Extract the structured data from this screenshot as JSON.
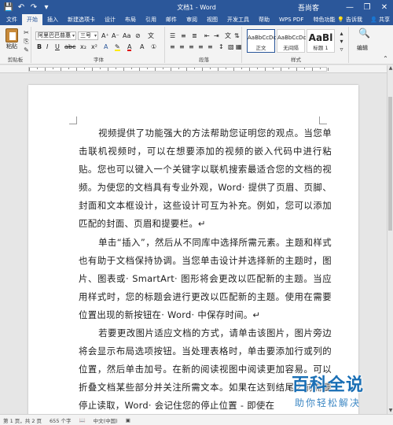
{
  "titlebar": {
    "title": "文档1 - Word",
    "account": "吾尚客",
    "minimize_icon": "minimize-icon",
    "restore_icon": "restore-icon",
    "close_icon": "close-icon"
  },
  "tabs": [
    "文件",
    "开始",
    "插入",
    "新建选项卡",
    "设计",
    "布局",
    "引用",
    "邮件",
    "审阅",
    "视图",
    "开发工具",
    "帮助",
    "WPS PDF",
    "特色功能"
  ],
  "active_tab": "开始",
  "tabs_right": {
    "tell_me": "告诉我",
    "share": "共享"
  },
  "ribbon": {
    "clipboard": {
      "paste_label": "粘贴",
      "group_label": "剪贴板"
    },
    "font": {
      "font_name": "阿里巴巴普惠",
      "font_size": "三号",
      "bold": "B",
      "italic": "I",
      "underline": "U",
      "group_label": "字体"
    },
    "paragraph": {
      "group_label": "段落"
    },
    "styles": {
      "items": [
        {
          "preview": "AaBbCcDc",
          "name": "正文"
        },
        {
          "preview": "AaBbCcDc",
          "name": "无间隔"
        },
        {
          "preview": "AaBl",
          "name": "标题 1"
        }
      ],
      "group_label": "样式"
    },
    "editing": {
      "label": "编辑"
    }
  },
  "document": {
    "paragraphs": [
      "视频提供了功能强大的方法帮助您证明您的观点。当您单击联机视频时，可以在想要添加的视频的嵌入代码中进行粘贴。您也可以键入一个关键字以联机搜索最适合您的文档的视频。为使您的文档具有专业外观，Word· 提供了页眉、页脚、封面和文本框设计，这些设计可互为补充。例如，您可以添加匹配的封面、页眉和提要栏。↵",
      "单击“插入”，然后从不同库中选择所需元素。主题和样式也有助于文档保持协调。当您单击设计并选择新的主题时，图片、图表或· SmartArt· 图形将会更改以匹配新的主题。当应用样式时，您的标题会进行更改以匹配新的主题。使用在需要位置出现的新按钮在· Word· 中保存时间。↵",
      "若要更改图片适应文档的方式，请单击该图片，图片旁边将会显示布局选项按钮。当处理表格时，单击要添加行或列的位置，然后单击加号。在新的阅读视图中阅读更加容易。可以折叠文档某些部分并关注所需文本。如果在达到结尾之前需要停止读取，Word· 会记住您的停止位置 - 即使在"
    ]
  },
  "statusbar": {
    "page": "第 1 页，共 2 页",
    "words": "655 个字",
    "language": "中文(中国)"
  },
  "watermark": {
    "title": "百科全说",
    "subtitle": "助你轻松解决"
  },
  "colors": {
    "accent": "#2b579a",
    "watermark": "#1a6fb5"
  }
}
